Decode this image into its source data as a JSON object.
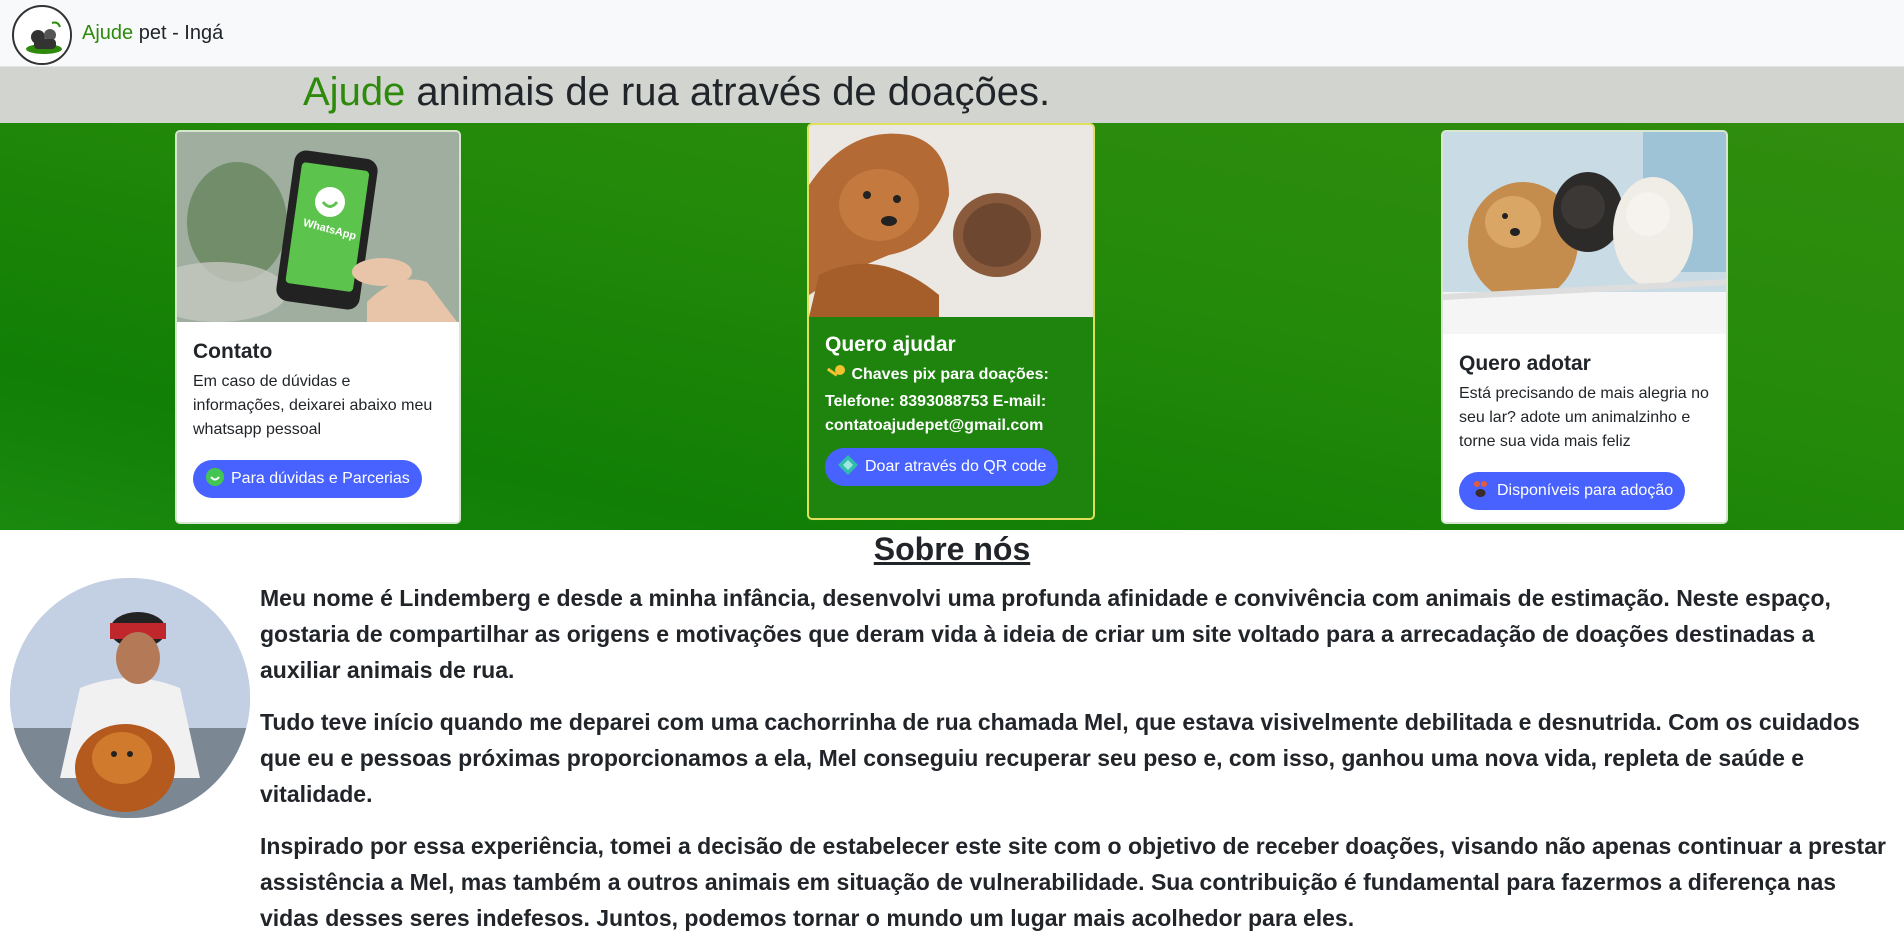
{
  "nav": {
    "brand_highlight": "Ajude",
    "brand_rest": " pet - Ingá"
  },
  "hero": {
    "headline_highlight": "Ajude",
    "headline_rest": " animais de rua através de doações."
  },
  "cards": {
    "contato": {
      "title": "Contato",
      "text": "Em caso de dúvidas e informações, deixarei abaixo meu whatsapp pessoal",
      "button": "Para dúvidas e Parcerias",
      "button_icon": "whatsapp-icon"
    },
    "ajudar": {
      "title": "Quero ajudar",
      "text": "Chaves pix para doações: Telefone: 8393088753 E-mail: contatoajudepet@gmail.com",
      "key_icon": "key-icon",
      "button": "Doar através do QR code",
      "button_icon": "pix-icon"
    },
    "adotar": {
      "title": "Quero adotar",
      "text": "Está precisando de mais alegria no seu lar? adote um animalzinho e torne sua vida mais feliz",
      "button": "Disponíveis para adoção",
      "button_icon": "paw-icon"
    }
  },
  "about": {
    "title": "Sobre nós",
    "paragraphs": [
      "Meu nome é Lindemberg e desde a minha infância, desenvolvi uma profunda afinidade e convivência com animais de estimação. Neste espaço, gostaria de compartilhar as origens e motivações que deram vida à ideia de criar um site voltado para a arrecadação de doações destinadas a auxiliar animais de rua.",
      "Tudo teve início quando me deparei com uma cachorrinha de rua chamada Mel, que estava visivelmente debilitada e desnutrida. Com os cuidados que eu e pessoas próximas proporcionamos a ela, Mel conseguiu recuperar seu peso e, com isso, ganhou uma nova vida, repleta de saúde e vitalidade.",
      "Inspirado por essa experiência, tomei a decisão de estabelecer este site com o objetivo de receber doações, visando não apenas continuar a prestar assistência a Mel, mas também a outros animais em situação de vulnerabilidade. Sua contribuição é fundamental para fazermos a diferença nas vidas desses seres indefesos. Juntos, podemos tornar o mundo um lugar mais acolhedor para eles."
    ]
  },
  "colors": {
    "brand_green": "#2e8a0b",
    "button_blue": "#4762ff",
    "hero_green": "#1f840e"
  }
}
